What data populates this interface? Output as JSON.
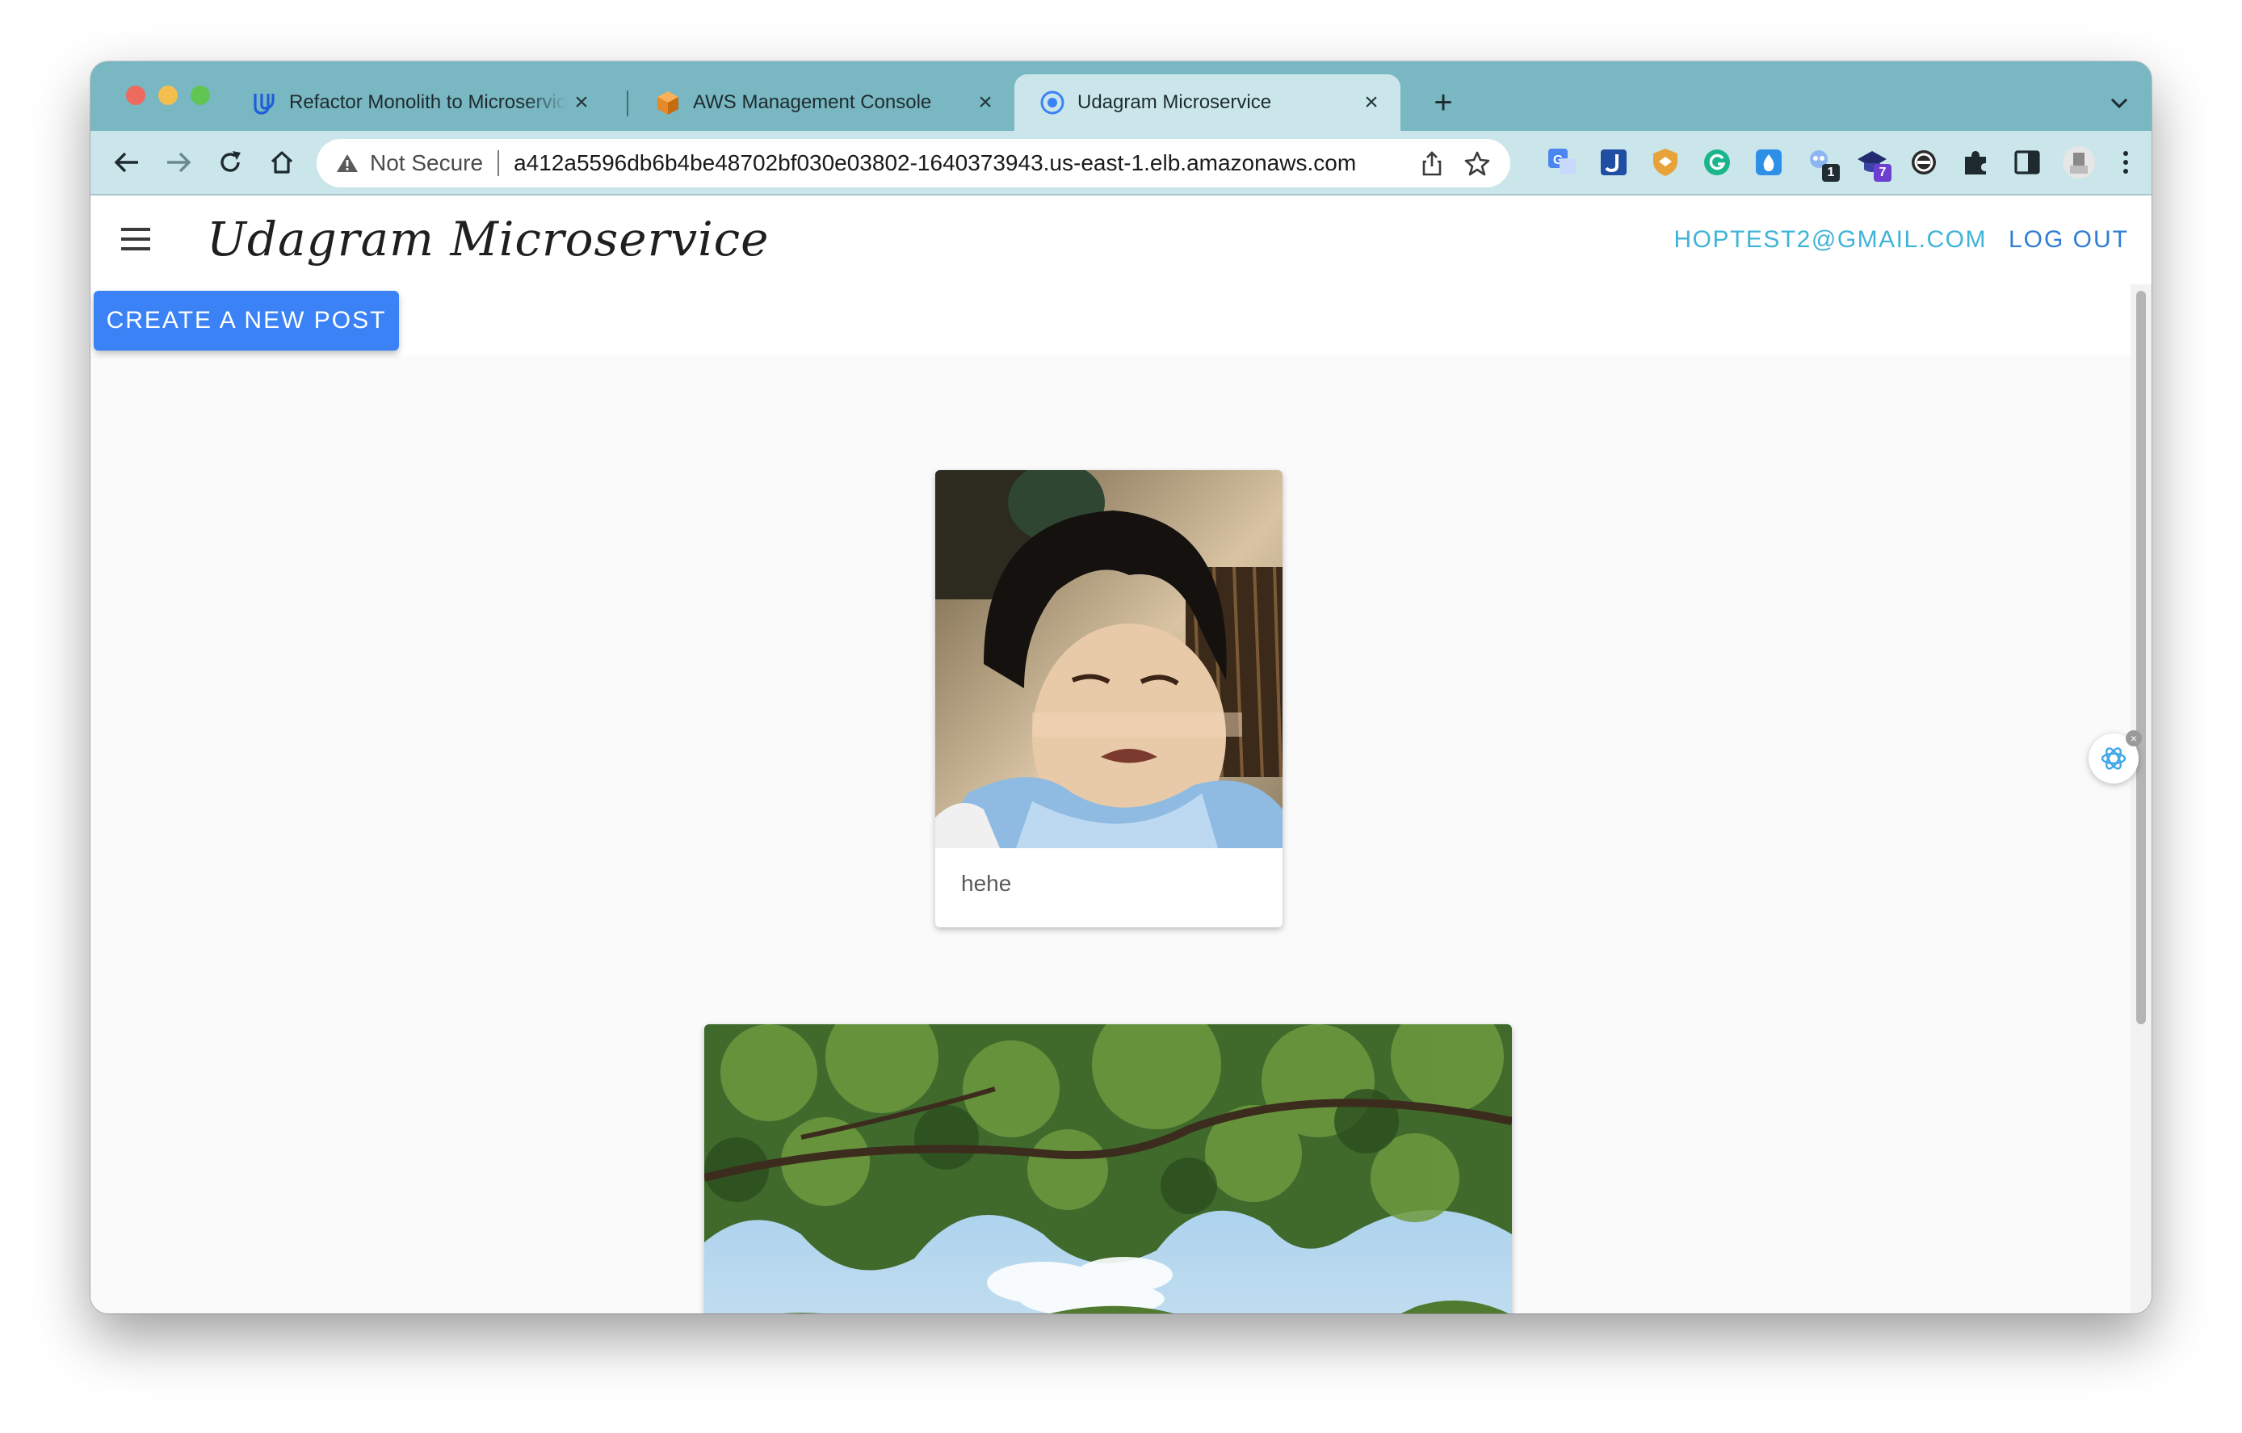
{
  "browser": {
    "tabs": [
      {
        "title": "Refactor Monolith to Microservices",
        "icon": "udacity-logo-icon",
        "active": false
      },
      {
        "title": "AWS Management Console",
        "icon": "aws-cube-icon",
        "active": false
      },
      {
        "title": "Udagram Microservice",
        "icon": "chrome-globe-icon",
        "active": true
      }
    ],
    "security_label": "Not Secure",
    "url": "a412a5596db6b4be48702bf030e03802-1640373943.us-east-1.elb.amazonaws.com",
    "extension_badges": {
      "grammar": "1",
      "academic": "7"
    }
  },
  "app": {
    "title": "Udagram Microservice",
    "user_email": "HOPTEST2@GMAIL.COM",
    "logout_label": "LOG OUT",
    "create_post_label": "CREATE A NEW POST"
  },
  "feed": [
    {
      "caption": "hehe",
      "image": "crying-toddler-photo"
    },
    {
      "caption": "",
      "image": "forest-canopy-photo"
    }
  ],
  "colors": {
    "tabstrip": "#79b7c2",
    "toolbar": "#cbe6ea",
    "primary_button": "#3b82f6",
    "email": "#3fb4d8",
    "logout": "#2f7dd4"
  }
}
